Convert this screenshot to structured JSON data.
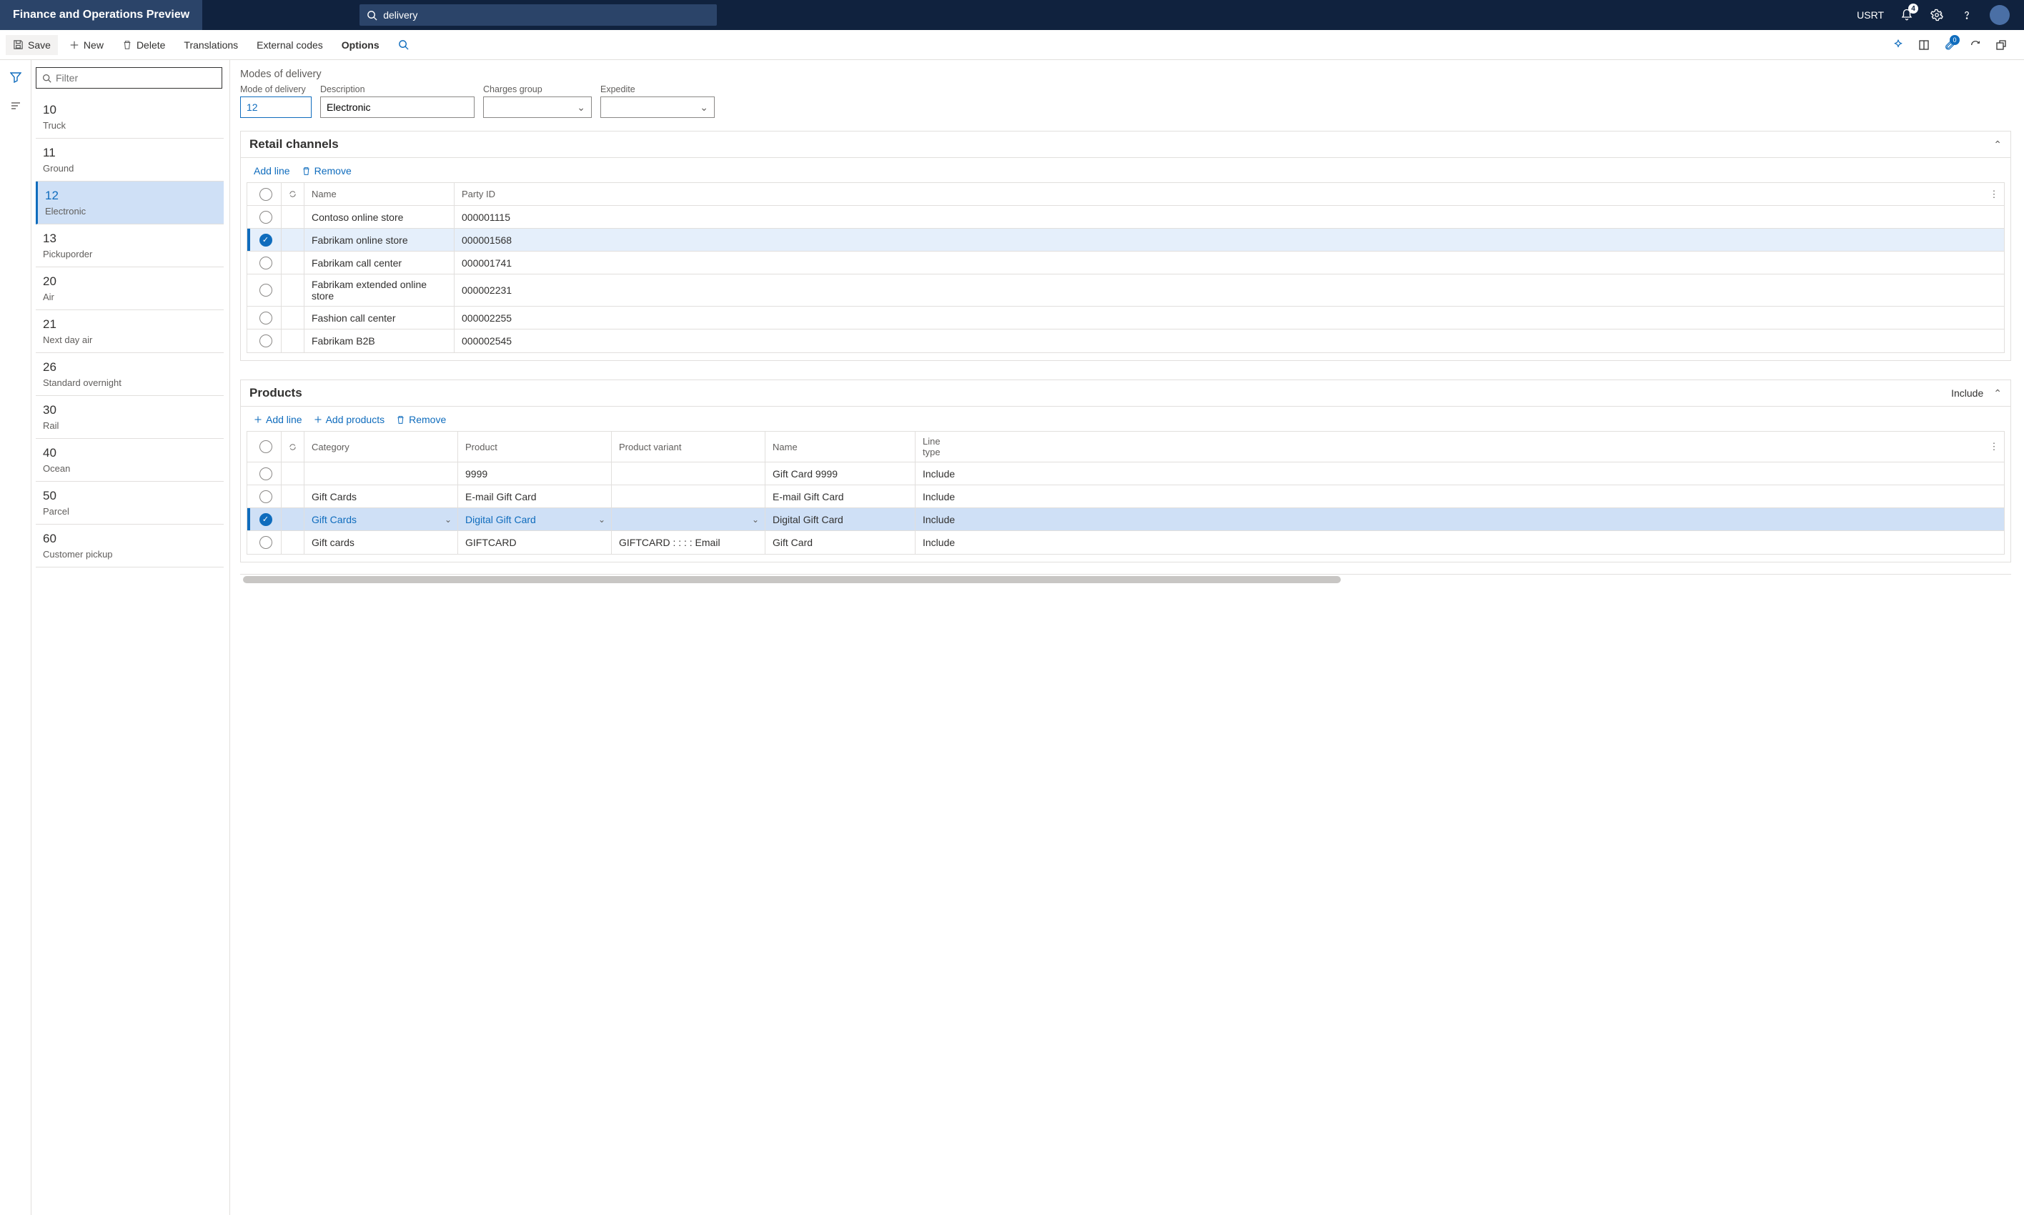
{
  "brand": "Finance and Operations Preview",
  "search_value": "delivery",
  "company": "USRT",
  "notif_count": "4",
  "actionbar": {
    "save": "Save",
    "new": "New",
    "delete": "Delete",
    "translations": "Translations",
    "external_codes": "External codes",
    "options": "Options",
    "attach_count": "0"
  },
  "filter_placeholder": "Filter",
  "modes": [
    {
      "code": "10",
      "desc": "Truck"
    },
    {
      "code": "11",
      "desc": "Ground"
    },
    {
      "code": "12",
      "desc": "Electronic",
      "selected": true
    },
    {
      "code": "13",
      "desc": "Pickuporder"
    },
    {
      "code": "20",
      "desc": "Air"
    },
    {
      "code": "21",
      "desc": "Next day air"
    },
    {
      "code": "26",
      "desc": "Standard overnight"
    },
    {
      "code": "30",
      "desc": "Rail"
    },
    {
      "code": "40",
      "desc": "Ocean"
    },
    {
      "code": "50",
      "desc": "Parcel"
    },
    {
      "code": "60",
      "desc": "Customer pickup"
    }
  ],
  "page_title": "Modes of delivery",
  "form": {
    "mode_label": "Mode of delivery",
    "mode_value": "12",
    "desc_label": "Description",
    "desc_value": "Electronic",
    "charges_label": "Charges group",
    "charges_value": "",
    "expedite_label": "Expedite",
    "expedite_value": ""
  },
  "rc": {
    "title": "Retail channels",
    "add_line": "Add line",
    "remove": "Remove",
    "col_name": "Name",
    "col_party": "Party ID",
    "rows": [
      {
        "name": "Contoso online store",
        "party": "000001115"
      },
      {
        "name": "Fabrikam online store",
        "party": "000001568",
        "marked": true
      },
      {
        "name": "Fabrikam call center",
        "party": "000001741"
      },
      {
        "name": "Fabrikam extended online store",
        "party": "000002231"
      },
      {
        "name": "Fashion call center",
        "party": "000002255"
      },
      {
        "name": "Fabrikam B2B",
        "party": "000002545"
      }
    ]
  },
  "pd": {
    "title": "Products",
    "include": "Include",
    "add_line": "Add line",
    "add_products": "Add products",
    "remove": "Remove",
    "col_category": "Category",
    "col_product": "Product",
    "col_variant": "Product variant",
    "col_name": "Name",
    "col_linetype": "Line type",
    "rows": [
      {
        "category": "",
        "product": "9999",
        "variant": "",
        "name": "Gift Card 9999",
        "linetype": "Include"
      },
      {
        "category": "Gift Cards",
        "product": "E-mail Gift Card",
        "variant": "",
        "name": "E-mail Gift Card",
        "linetype": "Include"
      },
      {
        "category": "Gift Cards",
        "product": "Digital Gift Card",
        "variant": "",
        "name": "Digital Gift Card",
        "linetype": "Include",
        "selected": true
      },
      {
        "category": "Gift cards",
        "product": "GIFTCARD",
        "variant": "GIFTCARD :  :  :  : Email",
        "name": "Gift Card",
        "linetype": "Include"
      }
    ]
  }
}
